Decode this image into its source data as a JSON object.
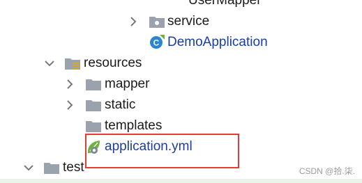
{
  "tree": {
    "top_partial": {
      "label": "UserMapper",
      "icon": "user-avatar-icon"
    },
    "service": {
      "label": "service",
      "icon": "package-folder-icon",
      "expanded": false
    },
    "demo_application": {
      "label": "DemoApplication",
      "icon": "spring-boot-class-icon"
    },
    "resources": {
      "label": "resources",
      "icon": "resources-folder-icon",
      "expanded": true
    },
    "mapper": {
      "label": "mapper",
      "icon": "folder-icon",
      "expanded": false
    },
    "static": {
      "label": "static",
      "icon": "folder-icon",
      "expanded": false
    },
    "templates": {
      "label": "templates",
      "icon": "folder-icon"
    },
    "application_yml": {
      "label": "application.yml",
      "icon": "spring-yml-file-icon"
    },
    "test": {
      "label": "test",
      "icon": "folder-icon",
      "expanded": true
    }
  },
  "colors": {
    "highlight_border": "#e23b3b",
    "file_link_text": "#1a3d9e",
    "folder_gray": "#9aa3ad",
    "spring_green": "#6db33f"
  },
  "watermark": "CSDN @拾.柒."
}
